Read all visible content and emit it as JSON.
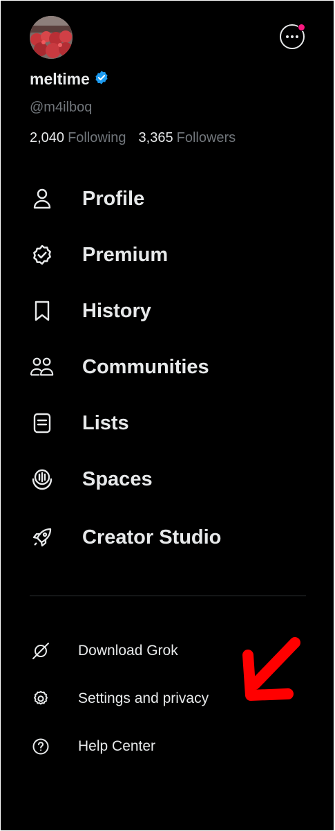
{
  "profile": {
    "display_name": "meltime",
    "handle": "@m4ilboq",
    "following_count": "2,040",
    "following_label": "Following",
    "followers_count": "3,365",
    "followers_label": "Followers",
    "verified_badge_color": "#1d9bf0",
    "notification_dot_color": "#f91880"
  },
  "nav": [
    {
      "label": "Profile",
      "icon": "person-icon"
    },
    {
      "label": "Premium",
      "icon": "verified-check-icon"
    },
    {
      "label": "History",
      "icon": "bookmark-icon"
    },
    {
      "label": "Communities",
      "icon": "people-icon"
    },
    {
      "label": "Lists",
      "icon": "list-icon"
    },
    {
      "label": "Spaces",
      "icon": "microphone-icon"
    },
    {
      "label": "Creator Studio",
      "icon": "rocket-icon"
    }
  ],
  "secondary": [
    {
      "label": "Download Grok",
      "icon": "grok-icon"
    },
    {
      "label": "Settings and privacy",
      "icon": "gear-icon"
    },
    {
      "label": "Help Center",
      "icon": "help-icon"
    }
  ],
  "annotation": {
    "arrow_color": "#ff0000"
  }
}
